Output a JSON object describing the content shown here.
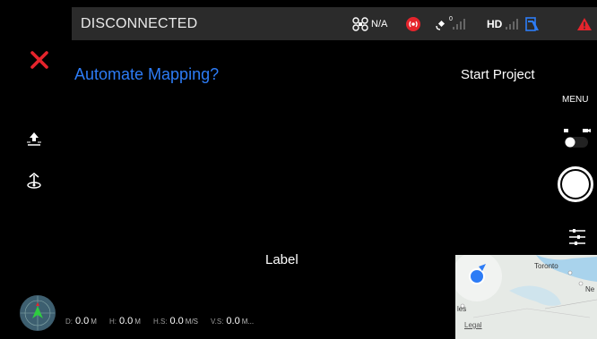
{
  "status": {
    "connection": "DISCONNECTED"
  },
  "topbar": {
    "gps_value": "N/A",
    "satellite_count": "0",
    "hd_label": "HD"
  },
  "main": {
    "title": "Automate Mapping?",
    "start_project_label": "Start Project",
    "menu_label": "MENU",
    "center_label": "Label"
  },
  "telemetry": {
    "distance": {
      "key": "D:",
      "value": "0.0",
      "unit": "M"
    },
    "height": {
      "key": "H:",
      "value": "0.0",
      "unit": "M"
    },
    "h_speed": {
      "key": "H.S:",
      "value": "0.0",
      "unit": "M/S"
    },
    "v_speed": {
      "key": "V.S:",
      "value": "0.0",
      "unit": "M..."
    }
  },
  "map": {
    "city_1": "Toronto",
    "city_2": "Ne",
    "city_3": "les",
    "legal": "Legal"
  },
  "colors": {
    "accent_blue": "#2d7cf6",
    "close_red": "#e5242c",
    "warning_red": "#e5242c"
  }
}
